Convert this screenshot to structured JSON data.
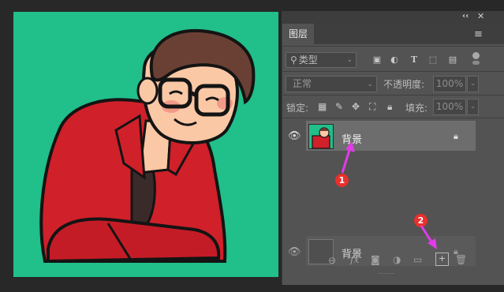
{
  "panel": {
    "collapse_label": "‹‹",
    "close_label": "✕",
    "tab_label": "图层",
    "menu_icon": "panel-menu-icon",
    "filter": {
      "label": "类型",
      "icon": "search-icon"
    },
    "filter_icons": [
      "image-filter-icon",
      "adjustment-filter-icon",
      "type-filter-icon",
      "shape-filter-icon",
      "smart-object-filter-icon"
    ],
    "blend_mode": "正常",
    "opacity_label": "不透明度:",
    "opacity_value": "100%",
    "lock_label": "锁定:",
    "lock_icons": [
      "lock-transparent-icon",
      "lock-paint-icon",
      "lock-move-icon",
      "lock-artboard-icon",
      "lock-all-icon"
    ],
    "fill_label": "填充:",
    "fill_value": "100%"
  },
  "layers": [
    {
      "name": "背景",
      "selected": true,
      "locked": true
    },
    {
      "name": "背景",
      "selected": false,
      "locked": true,
      "ghost": true
    }
  ],
  "bottom_icons": [
    "link-icon",
    "fx-icon",
    "mask-icon",
    "adjustment-icon",
    "folder-icon",
    "new-layer-icon",
    "trash-icon"
  ],
  "fx_label": "fx",
  "annotations": [
    {
      "label": "1"
    },
    {
      "label": "2"
    }
  ],
  "colors": {
    "canvas_bg": "#21bf8a",
    "annotation": "#e8302d",
    "arrow": "#e23be8"
  }
}
